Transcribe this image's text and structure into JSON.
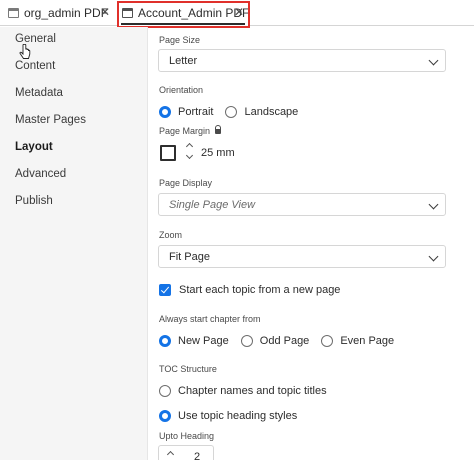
{
  "tabs": [
    {
      "label": "org_admin PDF"
    },
    {
      "label": "Account_Admin PDF"
    }
  ],
  "sidebar": {
    "items": [
      {
        "label": "General"
      },
      {
        "label": "Content"
      },
      {
        "label": "Metadata"
      },
      {
        "label": "Master Pages"
      },
      {
        "label": "Layout"
      },
      {
        "label": "Advanced"
      },
      {
        "label": "Publish"
      }
    ],
    "active": "Layout"
  },
  "layout": {
    "page_size": {
      "label": "Page Size",
      "value": "Letter"
    },
    "orientation": {
      "label": "Orientation",
      "options": [
        "Portrait",
        "Landscape"
      ],
      "selected": "Portrait"
    },
    "page_margin": {
      "label": "Page Margin",
      "value": "25 mm"
    },
    "page_display": {
      "label": "Page Display",
      "placeholder": "Single Page View"
    },
    "zoom": {
      "label": "Zoom",
      "value": "Fit Page"
    },
    "new_page_checkbox": {
      "label": "Start each topic from a new page",
      "checked": true
    },
    "chapter_start": {
      "label": "Always start chapter from",
      "options": [
        "New Page",
        "Odd Page",
        "Even Page"
      ],
      "selected": "New Page"
    },
    "toc_structure": {
      "label": "TOC Structure",
      "options": [
        "Chapter names and topic titles",
        "Use topic heading styles"
      ],
      "selected": "Use topic heading styles"
    },
    "upto_heading": {
      "label": "Upto Heading",
      "value": "2"
    }
  },
  "colors": {
    "accent": "#1473e6",
    "highlight": "#e0302b"
  }
}
